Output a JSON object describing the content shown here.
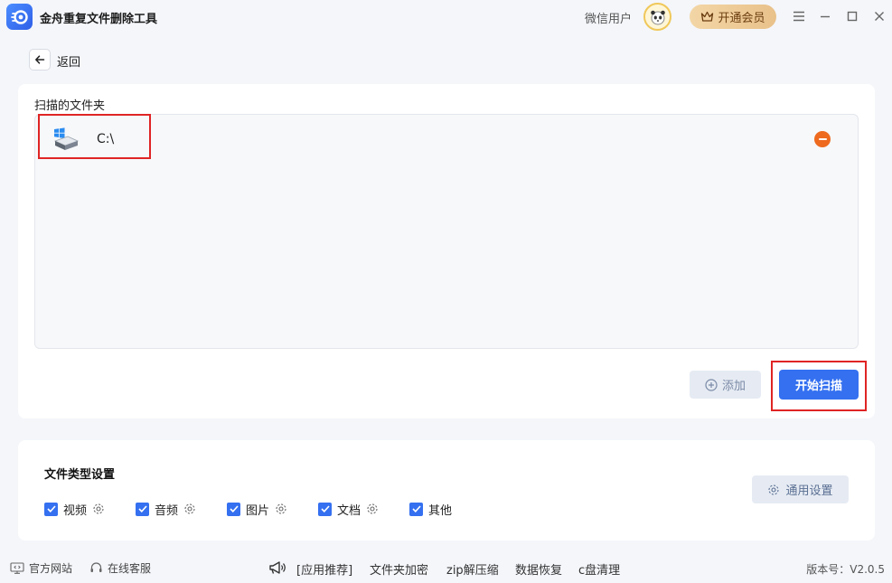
{
  "app": {
    "title": "金舟重复文件删除工具"
  },
  "header": {
    "user_name": "微信用户",
    "vip_label": "开通会员"
  },
  "nav": {
    "back_label": "返回"
  },
  "scan": {
    "section_label": "扫描的文件夹",
    "folders": [
      {
        "path": "C:\\"
      }
    ],
    "add_label": "添加",
    "start_label": "开始扫描"
  },
  "file_types": {
    "title": "文件类型设置",
    "items": [
      {
        "label": "视频",
        "checked": true,
        "has_settings": true
      },
      {
        "label": "音频",
        "checked": true,
        "has_settings": true
      },
      {
        "label": "图片",
        "checked": true,
        "has_settings": true
      },
      {
        "label": "文档",
        "checked": true,
        "has_settings": true
      },
      {
        "label": "其他",
        "checked": true,
        "has_settings": false
      }
    ],
    "general_settings_label": "通用设置"
  },
  "footer": {
    "official_site": "官方网站",
    "online_service": "在线客服",
    "recommend_label": "[应用推荐]",
    "recommend_apps": [
      "文件夹加密",
      "zip解压缩",
      "数据恢复",
      "c盘清理"
    ],
    "version": "版本号：V2.0.5"
  },
  "colors": {
    "accent": "#3470f0",
    "remove": "#ee6a1f",
    "highlight": "#e02424"
  }
}
